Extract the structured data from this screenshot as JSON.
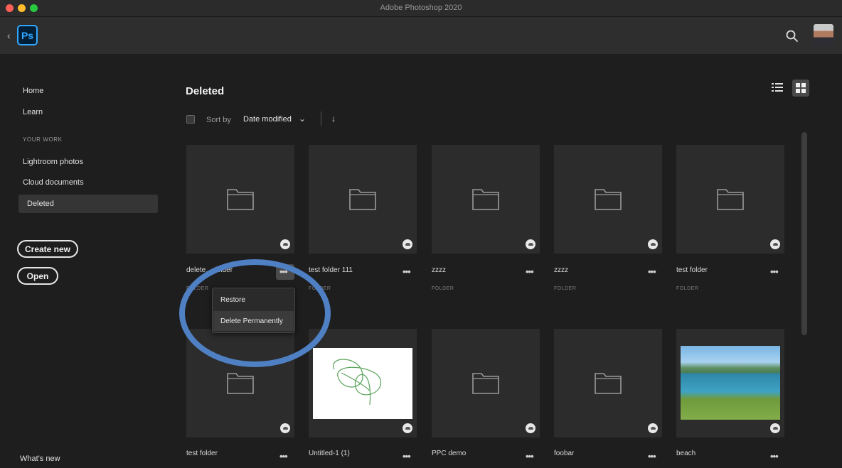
{
  "window": {
    "title": "Adobe Photoshop 2020",
    "lights": [
      "#fe5f57",
      "#febc2e",
      "#28c840"
    ]
  },
  "appbar": {
    "logo": "Ps",
    "back": "‹"
  },
  "sidebar": {
    "home": "Home",
    "learn": "Learn",
    "section": "YOUR WORK",
    "lightroom": "Lightroom photos",
    "cloud": "Cloud documents",
    "deleted": "Deleted",
    "create_new": "Create new",
    "open": "Open",
    "whats_new": "What's new"
  },
  "main": {
    "title": "Deleted",
    "sort_by": "Sort by",
    "sort_value": "Date modified",
    "sort_chevron": "⌄",
    "sort_arrow": "↓"
  },
  "items": [
    {
      "name": "delete… folder",
      "type": "FOLDER"
    },
    {
      "name": "test folder 111",
      "type": "FOLDER"
    },
    {
      "name": "zzzz",
      "type": "FOLDER"
    },
    {
      "name": "zzzz",
      "type": "FOLDER"
    },
    {
      "name": "test folder",
      "type": "FOLDER"
    },
    {
      "name": "test folder",
      "type": ""
    },
    {
      "name": "Untitled-1 (1)",
      "type": ""
    },
    {
      "name": "PPC demo",
      "type": ""
    },
    {
      "name": "foobar",
      "type": ""
    },
    {
      "name": "beach",
      "type": ""
    }
  ],
  "more_glyph": "•••",
  "context_menu": {
    "restore": "Restore",
    "delete": "Delete Permanently"
  },
  "colors": {
    "accent": "#31a8ff",
    "annotation": "#4f80c4"
  }
}
